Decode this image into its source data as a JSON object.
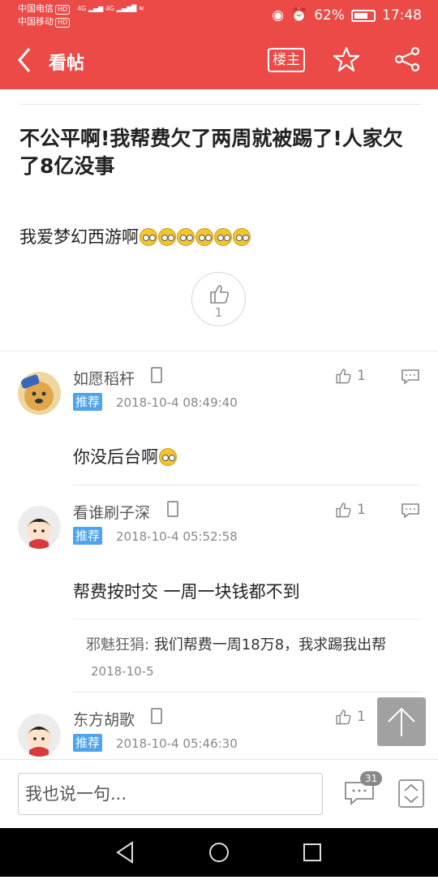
{
  "status_bar": {
    "carrier1": "中国电信",
    "carrier2": "中国移动",
    "hd": "HD",
    "net": "4G",
    "battery": "62%",
    "time": "17:48"
  },
  "header": {
    "title": "看帖",
    "owner_label": "楼主"
  },
  "post": {
    "title": "不公平啊!我帮费欠了两周就被踢了!人家欠了8亿没事",
    "body": "我爱梦幻西游啊",
    "like_count": "1"
  },
  "comments": [
    {
      "user": "如愿稻杆",
      "badge": "推荐",
      "time": "2018-10-4 08:49:40",
      "likes": "1",
      "text": "你没后台啊"
    },
    {
      "user": "看谁刷子深",
      "badge": "推荐",
      "time": "2018-10-4 05:52:58",
      "likes": "1",
      "text": "帮费按时交 一周一块钱都不到",
      "reply": {
        "who": "邪魅狂狷:",
        "text": "我们帮费一周18万8，我求踢我出帮",
        "date": "2018-10-5"
      }
    },
    {
      "user": "东方胡歌",
      "badge": "推荐",
      "time": "2018-10-4 05:46:30",
      "likes": "1",
      "text": ""
    }
  ],
  "bottom": {
    "input_placeholder": "我也说一句...",
    "comment_count": "31"
  },
  "colors": {
    "brand": "#ec4a46",
    "badge": "#4da3ec"
  }
}
